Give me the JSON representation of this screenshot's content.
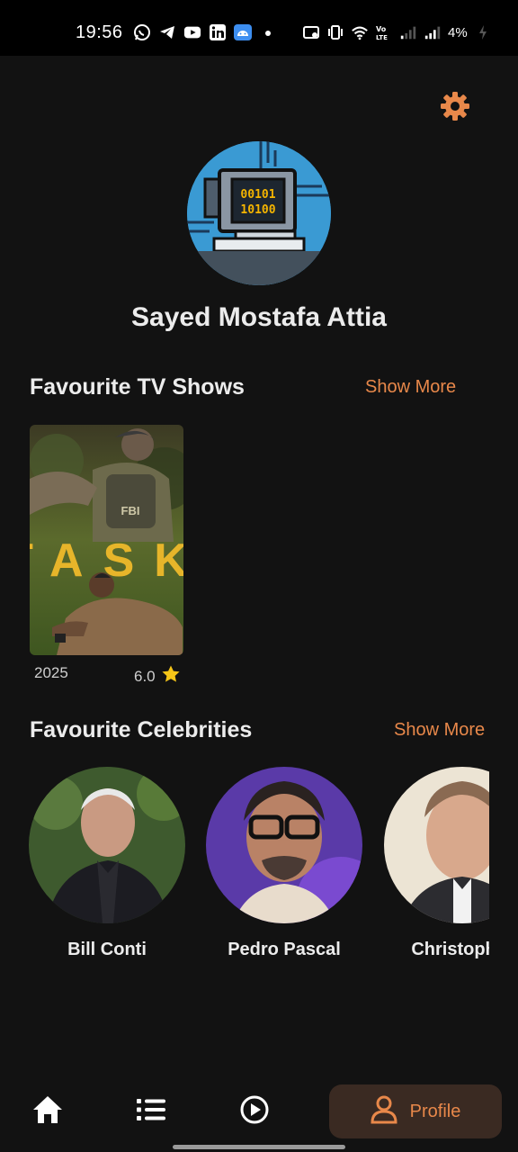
{
  "status_bar": {
    "time": "19:56",
    "battery": "4%",
    "left_icons": [
      "whatsapp-icon",
      "telegram-icon",
      "youtube-icon",
      "linkedin-icon",
      "android-icon",
      "dot-icon"
    ],
    "right_icons": [
      "screenshot-icon",
      "vibrate-icon",
      "wifi-icon",
      "volte-icon",
      "signal-icon",
      "signal-icon",
      "battery-icon"
    ]
  },
  "profile": {
    "name": "Sayed Mostafa Attia",
    "avatar_text_top": "00101",
    "avatar_text_bottom": "10100"
  },
  "tv_section": {
    "title": "Favourite TV Shows",
    "show_more": "Show More",
    "items": [
      {
        "poster_title": "TASK",
        "poster_badge": "FBI",
        "year": "2025",
        "rating": "6.0"
      }
    ]
  },
  "celebs_section": {
    "title": "Favourite Celebrities",
    "show_more": "Show More",
    "items": [
      {
        "name": "Bill Conti"
      },
      {
        "name": "Pedro Pascal"
      },
      {
        "name": "Christopher"
      }
    ]
  },
  "nav": {
    "items": [
      "home-icon",
      "list-icon",
      "play-icon"
    ],
    "profile_label": "Profile"
  },
  "colors": {
    "background": "#121212",
    "accent": "#e8884a",
    "profile_pill": "#3a2a22",
    "star": "#f5c518"
  }
}
